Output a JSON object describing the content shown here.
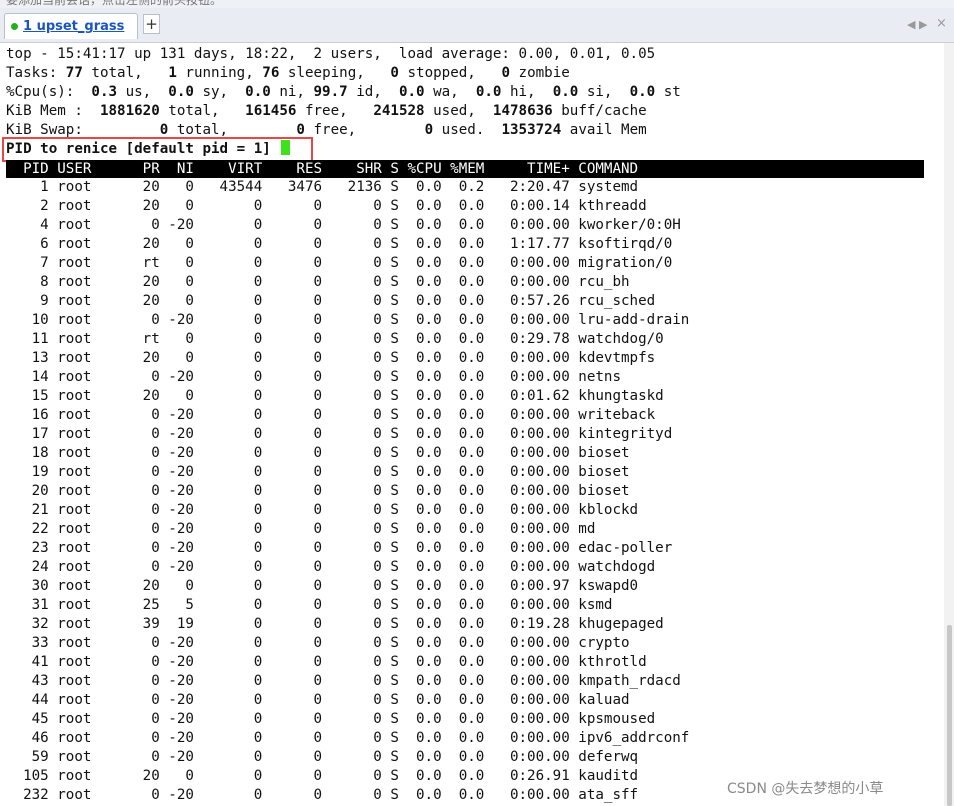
{
  "top_strip_text": "要添加当前会话，点击左侧的箭头按钮。",
  "tab": {
    "label": "1 upset_grass",
    "add_label": "+"
  },
  "nav": {
    "prev": "◀",
    "next": "▶",
    "close": "×"
  },
  "summary": {
    "line1": "top - 15:41:17 up 131 days, 18:22,  2 users,  load average: 0.00, 0.01, 0.05",
    "tasks": {
      "label": "Tasks: ",
      "total": "77",
      "total_lbl": " total,   ",
      "running": "1",
      "running_lbl": " running, ",
      "sleeping": "76",
      "sleeping_lbl": " sleeping,   ",
      "stopped": "0",
      "stopped_lbl": " stopped,   ",
      "zombie": "0",
      "zombie_lbl": " zombie"
    },
    "cpu": {
      "label": "%Cpu(s):  ",
      "us": "0.3",
      "us_lbl": " us,  ",
      "sy": "0.0",
      "sy_lbl": " sy,  ",
      "ni": "0.0",
      "ni_lbl": " ni, ",
      "id": "99.7",
      "id_lbl": " id,  ",
      "wa": "0.0",
      "wa_lbl": " wa,  ",
      "hi": "0.0",
      "hi_lbl": " hi,  ",
      "si": "0.0",
      "si_lbl": " si,  ",
      "st": "0.0",
      "st_lbl": " st"
    },
    "mem": {
      "label": "KiB Mem : ",
      "total": " 1881620",
      "total_lbl": " total,  ",
      "free": " 161456",
      "free_lbl": " free,  ",
      "used": " 241528",
      "used_lbl": " used,  ",
      "cache": "1478636",
      "cache_lbl": " buff/cache"
    },
    "swap": {
      "label": "KiB Swap:       ",
      "total": "  0",
      "total_lbl": " total,        ",
      "free": "0",
      "free_lbl": " free,        ",
      "used": "0",
      "used_lbl": " used.  ",
      "avail": "1353724",
      "avail_lbl": " avail Mem"
    }
  },
  "prompt": "PID to renice [default pid = 1] ",
  "header_line": "  PID USER      PR  NI    VIRT    RES    SHR S %CPU %MEM     TIME+ COMMAND",
  "processes": [
    [
      "1",
      "root",
      "20",
      "0",
      "43544",
      "3476",
      "2136",
      "S",
      "0.0",
      "0.2",
      "2:20.47",
      "systemd"
    ],
    [
      "2",
      "root",
      "20",
      "0",
      "0",
      "0",
      "0",
      "S",
      "0.0",
      "0.0",
      "0:00.14",
      "kthreadd"
    ],
    [
      "4",
      "root",
      "0",
      "-20",
      "0",
      "0",
      "0",
      "S",
      "0.0",
      "0.0",
      "0:00.00",
      "kworker/0:0H"
    ],
    [
      "6",
      "root",
      "20",
      "0",
      "0",
      "0",
      "0",
      "S",
      "0.0",
      "0.0",
      "1:17.77",
      "ksoftirqd/0"
    ],
    [
      "7",
      "root",
      "rt",
      "0",
      "0",
      "0",
      "0",
      "S",
      "0.0",
      "0.0",
      "0:00.00",
      "migration/0"
    ],
    [
      "8",
      "root",
      "20",
      "0",
      "0",
      "0",
      "0",
      "S",
      "0.0",
      "0.0",
      "0:00.00",
      "rcu_bh"
    ],
    [
      "9",
      "root",
      "20",
      "0",
      "0",
      "0",
      "0",
      "S",
      "0.0",
      "0.0",
      "0:57.26",
      "rcu_sched"
    ],
    [
      "10",
      "root",
      "0",
      "-20",
      "0",
      "0",
      "0",
      "S",
      "0.0",
      "0.0",
      "0:00.00",
      "lru-add-drain"
    ],
    [
      "11",
      "root",
      "rt",
      "0",
      "0",
      "0",
      "0",
      "S",
      "0.0",
      "0.0",
      "0:29.78",
      "watchdog/0"
    ],
    [
      "13",
      "root",
      "20",
      "0",
      "0",
      "0",
      "0",
      "S",
      "0.0",
      "0.0",
      "0:00.00",
      "kdevtmpfs"
    ],
    [
      "14",
      "root",
      "0",
      "-20",
      "0",
      "0",
      "0",
      "S",
      "0.0",
      "0.0",
      "0:00.00",
      "netns"
    ],
    [
      "15",
      "root",
      "20",
      "0",
      "0",
      "0",
      "0",
      "S",
      "0.0",
      "0.0",
      "0:01.62",
      "khungtaskd"
    ],
    [
      "16",
      "root",
      "0",
      "-20",
      "0",
      "0",
      "0",
      "S",
      "0.0",
      "0.0",
      "0:00.00",
      "writeback"
    ],
    [
      "17",
      "root",
      "0",
      "-20",
      "0",
      "0",
      "0",
      "S",
      "0.0",
      "0.0",
      "0:00.00",
      "kintegrityd"
    ],
    [
      "18",
      "root",
      "0",
      "-20",
      "0",
      "0",
      "0",
      "S",
      "0.0",
      "0.0",
      "0:00.00",
      "bioset"
    ],
    [
      "19",
      "root",
      "0",
      "-20",
      "0",
      "0",
      "0",
      "S",
      "0.0",
      "0.0",
      "0:00.00",
      "bioset"
    ],
    [
      "20",
      "root",
      "0",
      "-20",
      "0",
      "0",
      "0",
      "S",
      "0.0",
      "0.0",
      "0:00.00",
      "bioset"
    ],
    [
      "21",
      "root",
      "0",
      "-20",
      "0",
      "0",
      "0",
      "S",
      "0.0",
      "0.0",
      "0:00.00",
      "kblockd"
    ],
    [
      "22",
      "root",
      "0",
      "-20",
      "0",
      "0",
      "0",
      "S",
      "0.0",
      "0.0",
      "0:00.00",
      "md"
    ],
    [
      "23",
      "root",
      "0",
      "-20",
      "0",
      "0",
      "0",
      "S",
      "0.0",
      "0.0",
      "0:00.00",
      "edac-poller"
    ],
    [
      "24",
      "root",
      "0",
      "-20",
      "0",
      "0",
      "0",
      "S",
      "0.0",
      "0.0",
      "0:00.00",
      "watchdogd"
    ],
    [
      "30",
      "root",
      "20",
      "0",
      "0",
      "0",
      "0",
      "S",
      "0.0",
      "0.0",
      "0:00.97",
      "kswapd0"
    ],
    [
      "31",
      "root",
      "25",
      "5",
      "0",
      "0",
      "0",
      "S",
      "0.0",
      "0.0",
      "0:00.00",
      "ksmd"
    ],
    [
      "32",
      "root",
      "39",
      "19",
      "0",
      "0",
      "0",
      "S",
      "0.0",
      "0.0",
      "0:19.28",
      "khugepaged"
    ],
    [
      "33",
      "root",
      "0",
      "-20",
      "0",
      "0",
      "0",
      "S",
      "0.0",
      "0.0",
      "0:00.00",
      "crypto"
    ],
    [
      "41",
      "root",
      "0",
      "-20",
      "0",
      "0",
      "0",
      "S",
      "0.0",
      "0.0",
      "0:00.00",
      "kthrotld"
    ],
    [
      "43",
      "root",
      "0",
      "-20",
      "0",
      "0",
      "0",
      "S",
      "0.0",
      "0.0",
      "0:00.00",
      "kmpath_rdacd"
    ],
    [
      "44",
      "root",
      "0",
      "-20",
      "0",
      "0",
      "0",
      "S",
      "0.0",
      "0.0",
      "0:00.00",
      "kaluad"
    ],
    [
      "45",
      "root",
      "0",
      "-20",
      "0",
      "0",
      "0",
      "S",
      "0.0",
      "0.0",
      "0:00.00",
      "kpsmoused"
    ],
    [
      "46",
      "root",
      "0",
      "-20",
      "0",
      "0",
      "0",
      "S",
      "0.0",
      "0.0",
      "0:00.00",
      "ipv6_addrconf"
    ],
    [
      "59",
      "root",
      "0",
      "-20",
      "0",
      "0",
      "0",
      "S",
      "0.0",
      "0.0",
      "0:00.00",
      "deferwq"
    ],
    [
      "105",
      "root",
      "20",
      "0",
      "0",
      "0",
      "0",
      "S",
      "0.0",
      "0.0",
      "0:26.91",
      "kauditd"
    ],
    [
      "232",
      "root",
      "0",
      "-20",
      "0",
      "0",
      "0",
      "S",
      "0.0",
      "0.0",
      "0:00.00",
      "ata_sff"
    ]
  ],
  "watermark": "CSDN @失去梦想的小草",
  "colors": {
    "cursor": "#3ee21b",
    "highlight_box": "#e64848",
    "header_bg": "#000000",
    "tab_label": "#1a55c0"
  }
}
